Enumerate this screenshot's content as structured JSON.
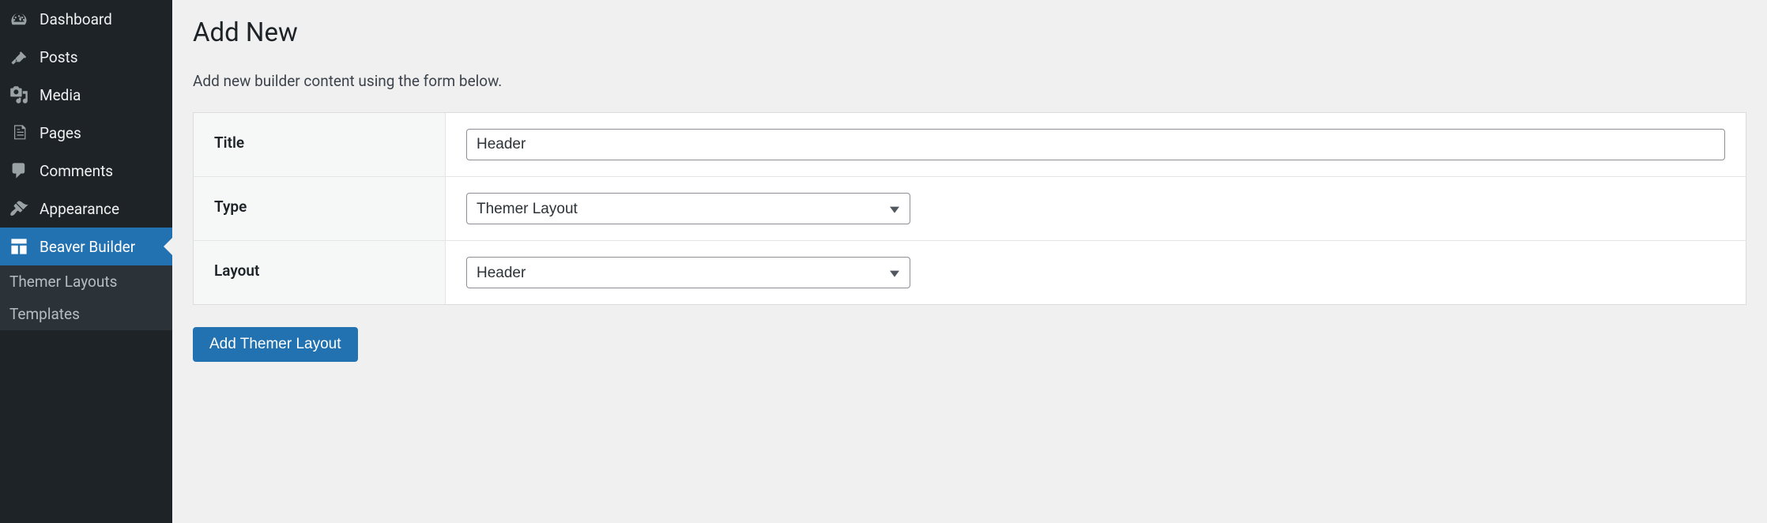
{
  "sidebar": {
    "items": [
      {
        "label": "Dashboard",
        "icon": "dashboard"
      },
      {
        "label": "Posts",
        "icon": "pin"
      },
      {
        "label": "Media",
        "icon": "media"
      },
      {
        "label": "Pages",
        "icon": "pages"
      },
      {
        "label": "Comments",
        "icon": "comment"
      },
      {
        "label": "Appearance",
        "icon": "brush"
      },
      {
        "label": "Beaver Builder",
        "icon": "layout",
        "active": true
      }
    ],
    "subitems": [
      {
        "label": "Themer Layouts"
      },
      {
        "label": "Templates"
      }
    ]
  },
  "page": {
    "title": "Add New",
    "description": "Add new builder content using the form below."
  },
  "form": {
    "title_label": "Title",
    "title_value": "Header",
    "type_label": "Type",
    "type_value": "Themer Layout",
    "layout_label": "Layout",
    "layout_value": "Header",
    "submit_label": "Add Themer Layout"
  }
}
